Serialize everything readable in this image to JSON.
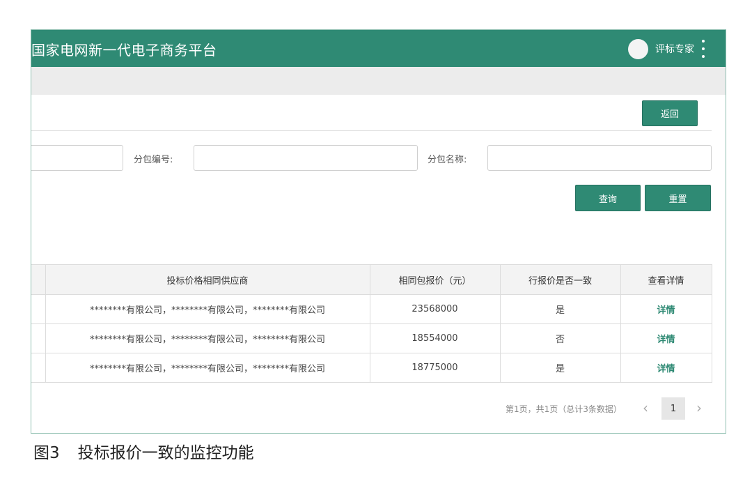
{
  "header": {
    "app_title": "国家电网新一代电子商务平台",
    "user_name": "评标专家"
  },
  "toolbar": {
    "back_label": "返回"
  },
  "filters": {
    "package_no_label": "分包编号:",
    "package_name_label": "分包名称:",
    "package_no_value": "",
    "package_name_value": "",
    "query_label": "查询",
    "reset_label": "重置"
  },
  "table": {
    "columns": [
      "投标价格相同供应商",
      "相同包报价（元）",
      "行报价是否一致",
      "查看详情"
    ],
    "rows": [
      {
        "suppliers": "********有限公司，********有限公司，********有限公司",
        "price": "23568000",
        "consistent": "是",
        "action": "详情"
      },
      {
        "suppliers": "********有限公司，********有限公司，********有限公司",
        "price": "18554000",
        "consistent": "否",
        "action": "详情"
      },
      {
        "suppliers": "********有限公司，********有限公司，********有限公司",
        "price": "18775000",
        "consistent": "是",
        "action": "详情"
      }
    ]
  },
  "pagination": {
    "summary": "第1页，共1页（总计3条数据）",
    "current_page": "1",
    "prev_icon": "chevron-left-icon",
    "next_icon": "chevron-right-icon"
  },
  "caption": {
    "figure_no": "图3",
    "text": "投标报价一致的监控功能"
  },
  "colors": {
    "brand": "#2f8a74",
    "header_bg": "#2f8a74",
    "subbar_bg": "#ececec"
  }
}
